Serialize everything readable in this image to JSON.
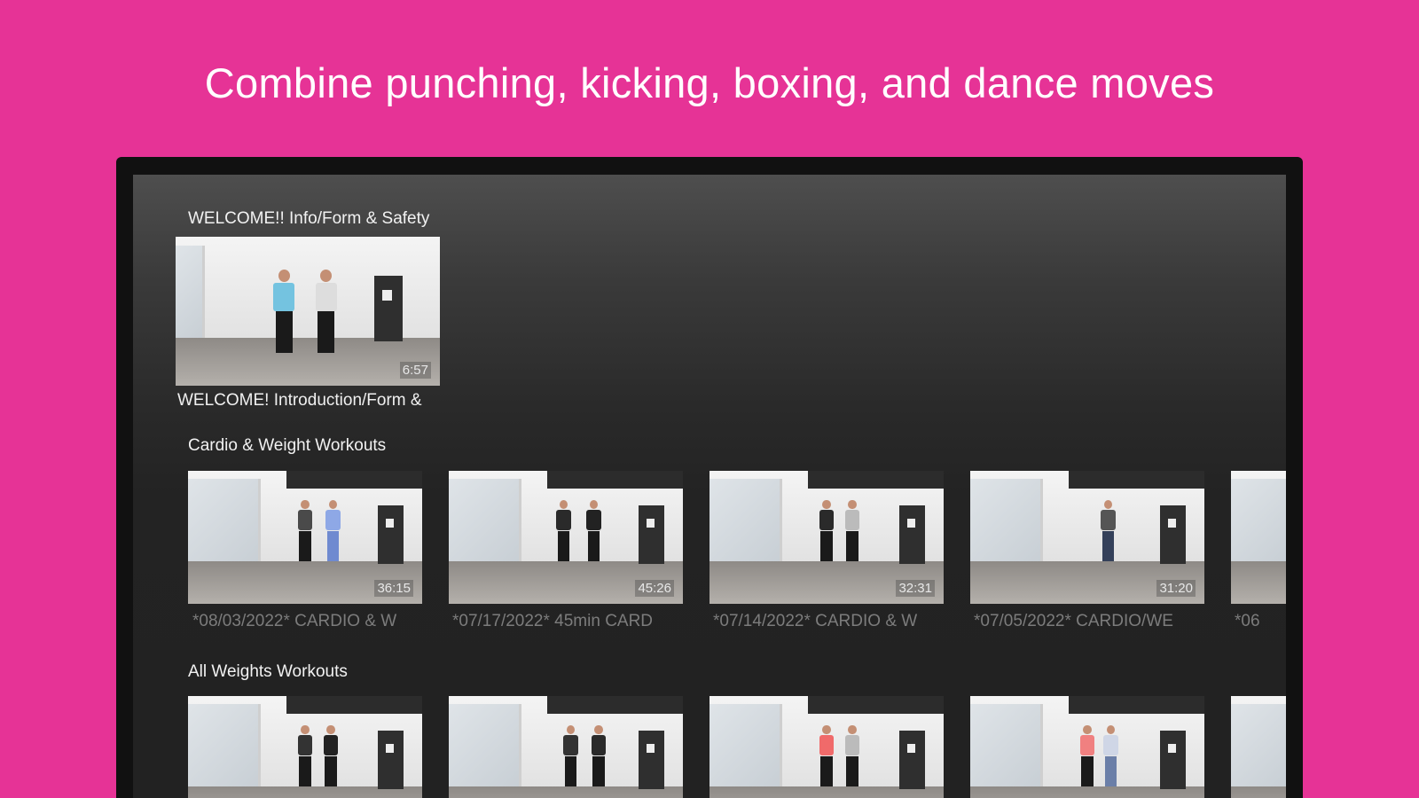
{
  "headline": "Combine punching, kicking, boxing, and dance moves",
  "sections": [
    {
      "title": "WELCOME!! Info/Form & Safety",
      "videos": [
        {
          "title": "WELCOME! Introduction/Form &",
          "duration": "6:57"
        }
      ]
    },
    {
      "title": "Cardio & Weight Workouts",
      "videos": [
        {
          "title": "*08/03/2022* CARDIO & W",
          "duration": "36:15"
        },
        {
          "title": "*07/17/2022* 45min CARD",
          "duration": "45:26"
        },
        {
          "title": "*07/14/2022* CARDIO & W",
          "duration": "32:31"
        },
        {
          "title": "*07/05/2022* CARDIO/WE",
          "duration": "31:20"
        },
        {
          "title": "*06",
          "duration": ""
        }
      ]
    },
    {
      "title": "All Weights Workouts",
      "videos": [
        {
          "title": "",
          "duration": ""
        },
        {
          "title": "",
          "duration": ""
        },
        {
          "title": "",
          "duration": ""
        },
        {
          "title": "",
          "duration": ""
        },
        {
          "title": "",
          "duration": ""
        }
      ]
    }
  ],
  "colors": {
    "background": "#e63396",
    "tv_frame": "#111111",
    "screen": "#222222"
  }
}
